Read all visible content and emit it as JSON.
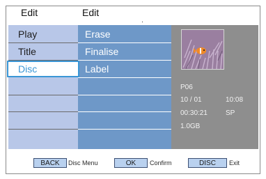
{
  "header": {
    "left_title": "Edit",
    "right_title": "Edit"
  },
  "menu_left": [
    {
      "label": "Play"
    },
    {
      "label": "Title"
    },
    {
      "label": "Disc",
      "selected": true
    }
  ],
  "menu_right": [
    {
      "label": "Erase"
    },
    {
      "label": "Finalise"
    },
    {
      "label": "Label"
    }
  ],
  "details": {
    "title_id": "P06",
    "date": "10 / 01",
    "time": "10:08",
    "duration": "00:30:21",
    "mode": "SP",
    "size": "1.0GB"
  },
  "footer": {
    "back_button": "BACK",
    "back_desc": "Disc Menu",
    "ok_button": "OK",
    "ok_desc": "Confirm",
    "disc_button": "DISC",
    "disc_desc": "Exit"
  }
}
